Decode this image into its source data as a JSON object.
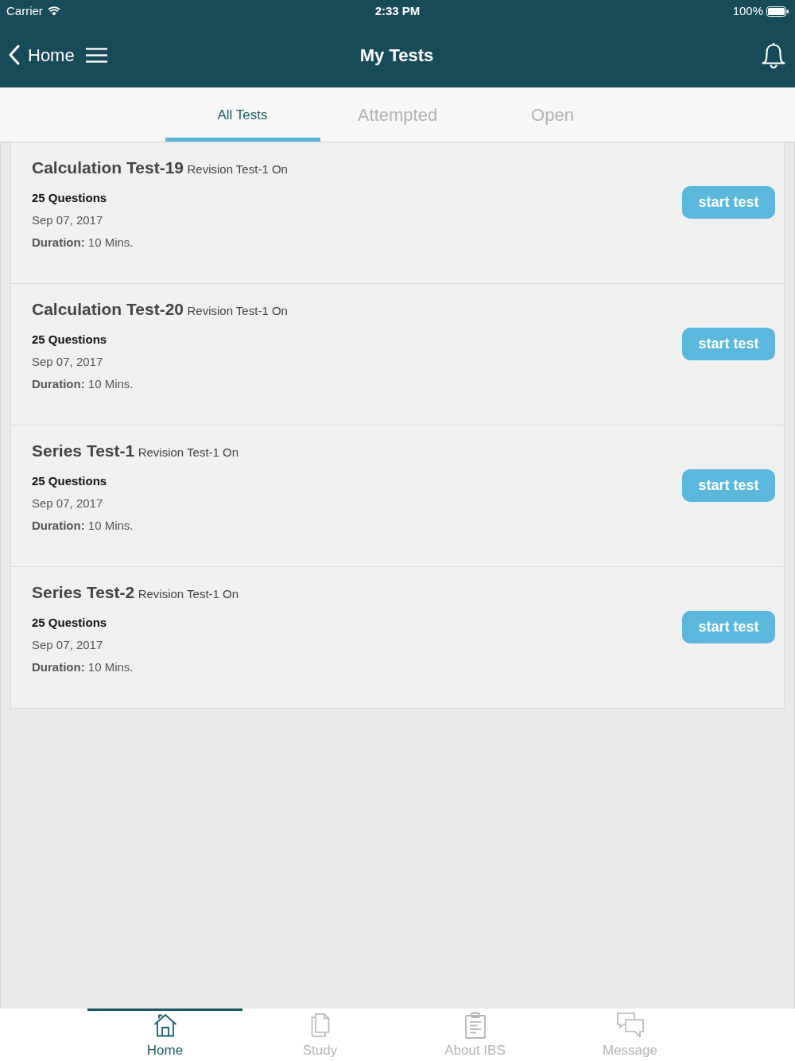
{
  "status_bar": {
    "carrier": "Carrier",
    "time": "2:33 PM",
    "battery": "100%"
  },
  "nav_bar": {
    "back_label": "Home",
    "title": "My Tests"
  },
  "tabs": [
    {
      "label": "All Tests",
      "selected": true
    },
    {
      "label": "Attempted",
      "selected": false
    },
    {
      "label": "Open",
      "selected": false
    }
  ],
  "tests": [
    {
      "title": "Calculation Test-19",
      "subtitle": "Revision Test-1 On",
      "questions": "25 Questions",
      "date": "Sep 07, 2017",
      "duration": "**Duration:** 10 Mins.",
      "button": "start test"
    },
    {
      "title": "Calculation Test-20",
      "subtitle": "Revision Test-1 On",
      "questions": "25 Questions",
      "date": "Sep 07, 2017",
      "duration": "**Duration:** 10 Mins.",
      "button": "start test"
    },
    {
      "title": "Series Test-1",
      "subtitle": "Revision Test-1 On",
      "questions": "25 Questions",
      "date": "Sep 07, 2017",
      "duration": "**Duration:** 10 Mins.",
      "button": "start test"
    },
    {
      "title": "Series Test-2",
      "subtitle": "Revision Test-1 On",
      "questions": "25 Questions",
      "date": "Sep 07, 2017",
      "duration": "**Duration:** 10 Mins.",
      "button": "start test"
    }
  ],
  "tab_bar": [
    {
      "label": "Home",
      "kind": "home",
      "selected": true
    },
    {
      "label": "Study",
      "kind": "study",
      "selected": false
    },
    {
      "label": "About IBS",
      "kind": "about",
      "selected": false
    },
    {
      "label": "Message",
      "kind": "message",
      "selected": false
    }
  ]
}
